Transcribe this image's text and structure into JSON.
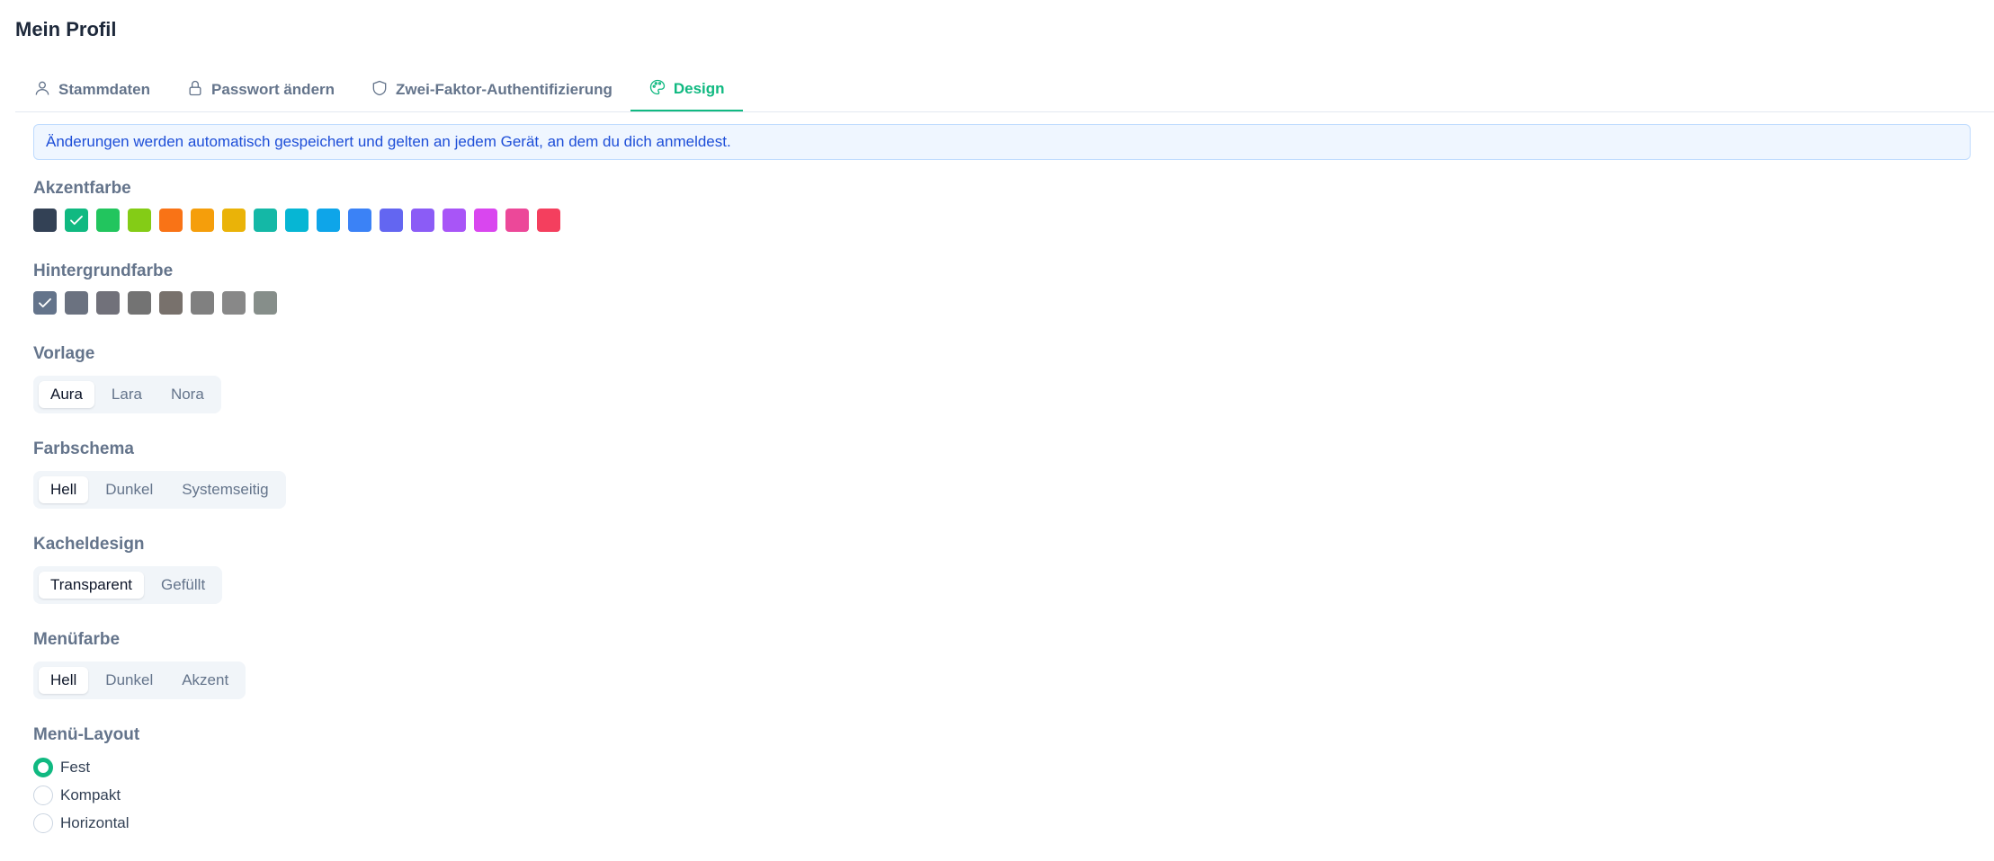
{
  "page_title": "Mein Profil",
  "tabs": [
    {
      "label": "Stammdaten",
      "icon": "user-icon"
    },
    {
      "label": "Passwort ändern",
      "icon": "lock-icon"
    },
    {
      "label": "Zwei-Faktor-Authentifizierung",
      "icon": "shield-icon"
    },
    {
      "label": "Design",
      "icon": "palette-icon",
      "active": true
    }
  ],
  "info_message": "Änderungen werden automatisch gespeichert und gelten an jedem Gerät, an dem du dich anmeldest.",
  "accent": {
    "label": "Akzentfarbe",
    "colors": [
      "#334155",
      "#10b981",
      "#22c55e",
      "#84cc16",
      "#f97316",
      "#f59e0b",
      "#eab308",
      "#14b8a6",
      "#06b6d4",
      "#0ea5e9",
      "#3b82f6",
      "#6366f1",
      "#8b5cf6",
      "#a855f7",
      "#d946ef",
      "#ec4899",
      "#f43f5e"
    ],
    "selected_index": 1
  },
  "background": {
    "label": "Hintergrundfarbe",
    "colors": [
      "#64748b",
      "#6b7280",
      "#71717a",
      "#737373",
      "#78716c",
      "#808080",
      "#888888",
      "#868e8a"
    ],
    "selected_index": 0
  },
  "template": {
    "label": "Vorlage",
    "options": [
      "Aura",
      "Lara",
      "Nora"
    ],
    "selected": 0
  },
  "color_scheme": {
    "label": "Farbschema",
    "options": [
      "Hell",
      "Dunkel",
      "Systemseitig"
    ],
    "selected": 0
  },
  "tile_design": {
    "label": "Kacheldesign",
    "options": [
      "Transparent",
      "Gefüllt"
    ],
    "selected": 0
  },
  "menu_color": {
    "label": "Menüfarbe",
    "options": [
      "Hell",
      "Dunkel",
      "Akzent"
    ],
    "selected": 0
  },
  "menu_layout": {
    "label": "Menü-Layout",
    "options": [
      "Fest",
      "Kompakt",
      "Horizontal"
    ],
    "selected": 0
  },
  "colors": {
    "primary": "#10b981",
    "info_text": "#1d4ed8",
    "info_bg": "#eff6ff"
  }
}
